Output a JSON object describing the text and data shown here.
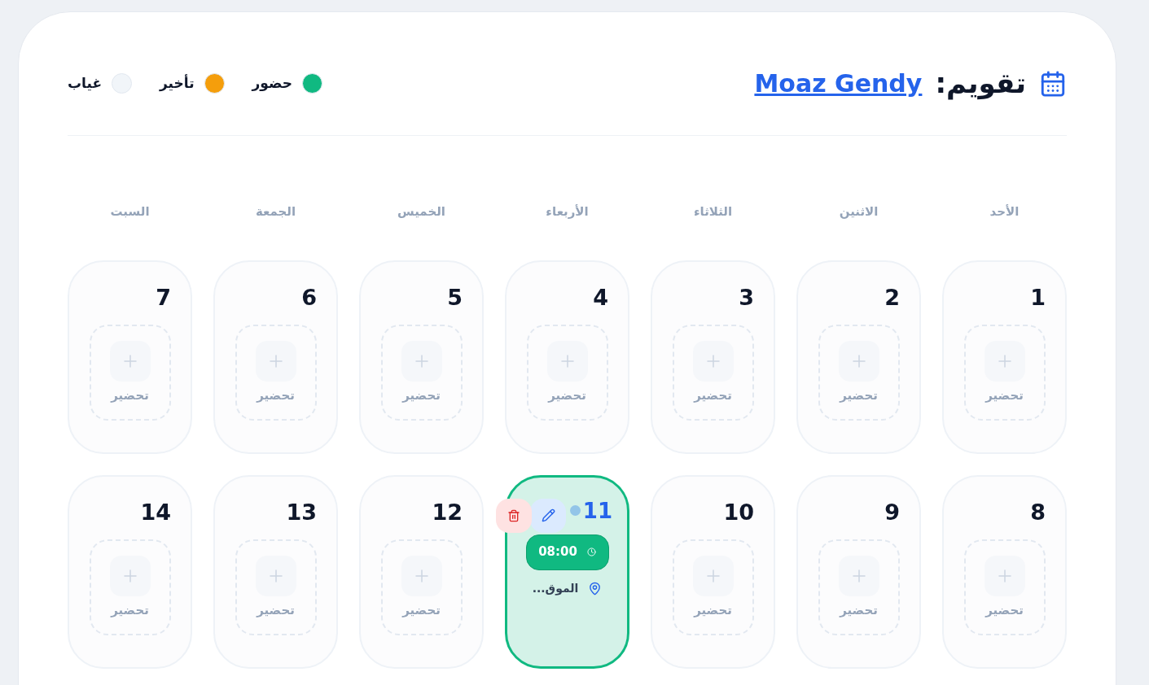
{
  "header": {
    "title": "تقويم:",
    "user_link": "Moaz Gendy"
  },
  "legend": [
    {
      "label": "حضور",
      "color": "#10b981"
    },
    {
      "label": "تأخير",
      "color": "#f59e0b"
    },
    {
      "label": "غياب",
      "color": "#f1f5f9"
    }
  ],
  "weekdays": [
    "الأحد",
    "الاثنين",
    "الثلاثاء",
    "الأربعاء",
    "الخميس",
    "الجمعة",
    "السبت"
  ],
  "days": [
    {
      "number": "1",
      "kind": "empty",
      "today": false,
      "action": "تحضير"
    },
    {
      "number": "2",
      "kind": "empty",
      "today": false,
      "action": "تحضير"
    },
    {
      "number": "3",
      "kind": "empty",
      "today": false,
      "action": "تحضير"
    },
    {
      "number": "4",
      "kind": "empty",
      "today": false,
      "action": "تحضير"
    },
    {
      "number": "5",
      "kind": "empty",
      "today": false,
      "action": "تحضير"
    },
    {
      "number": "6",
      "kind": "empty",
      "today": false,
      "action": "تحضير"
    },
    {
      "number": "7",
      "kind": "empty",
      "today": false,
      "action": "تحضير"
    },
    {
      "number": "8",
      "kind": "empty",
      "today": false,
      "action": "تحضير"
    },
    {
      "number": "9",
      "kind": "empty",
      "today": false,
      "action": "تحضير"
    },
    {
      "number": "10",
      "kind": "empty",
      "today": false,
      "action": "تحضير"
    },
    {
      "number": "11",
      "kind": "record",
      "today": true,
      "color": "#10b981",
      "time": "08:00",
      "location": "الموق..."
    },
    {
      "number": "12",
      "kind": "empty",
      "today": false,
      "action": "تحضير"
    },
    {
      "number": "13",
      "kind": "empty",
      "today": false,
      "action": "تحضير"
    },
    {
      "number": "14",
      "kind": "empty",
      "today": false,
      "action": "تحضير"
    }
  ]
}
